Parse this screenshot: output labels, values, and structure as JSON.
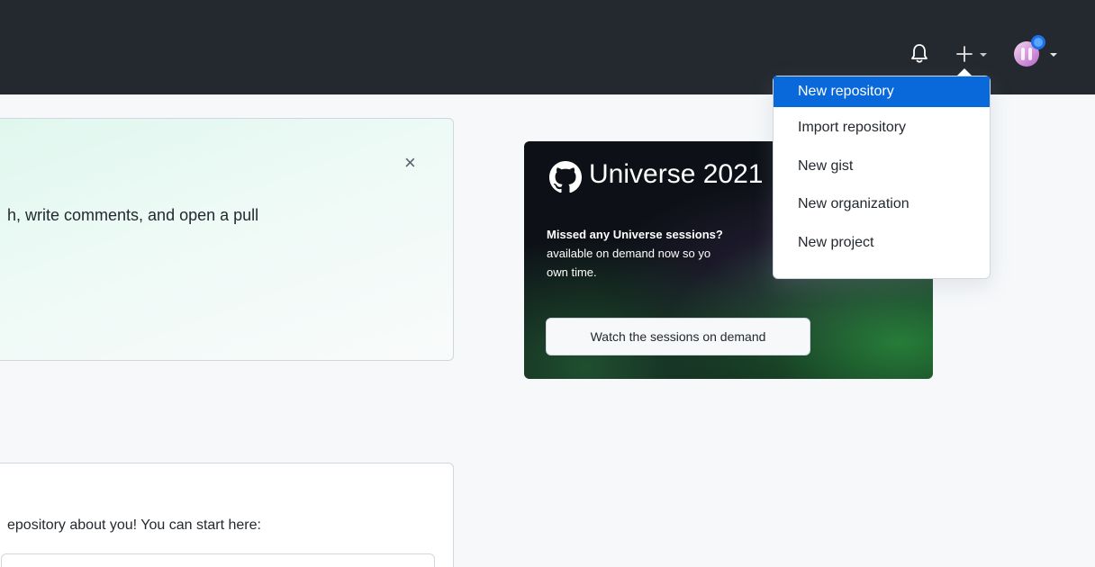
{
  "header": {
    "notification_icon": "bell-icon",
    "create_icon": "plus-icon",
    "avatar_icon": "avatar-icon"
  },
  "create_menu": {
    "items": [
      {
        "label": "New repository",
        "active": true
      },
      {
        "label": "Import repository"
      },
      {
        "label": "New gist"
      },
      {
        "label": "New organization"
      },
      {
        "label": "New project"
      }
    ]
  },
  "welcome_card": {
    "text": "h, write comments, and open a pull",
    "close_icon": "close-icon"
  },
  "profile_card": {
    "text": "epository about you! You can start here:"
  },
  "universe_promo": {
    "title": "Universe 2021",
    "bold_line": "Missed any Universe sessions?",
    "line_2": "available on demand now so yo",
    "line_3": "own time.",
    "button_label": "Watch the sessions on demand"
  },
  "colors": {
    "header_bg": "#24292f",
    "page_bg": "#f6f8fa",
    "menu_active": "#0969da",
    "promo_bg": "#0d1117",
    "accent_green": "#2ea043"
  }
}
